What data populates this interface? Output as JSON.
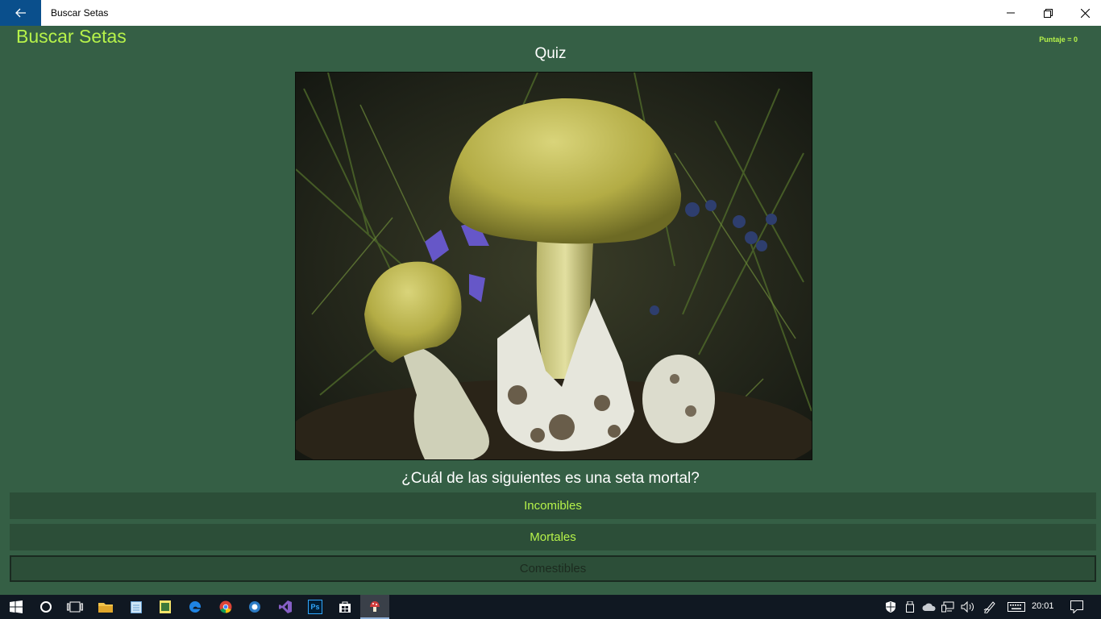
{
  "window": {
    "title": "Buscar Setas"
  },
  "app": {
    "title": "Buscar Setas",
    "score_label": "Puntaje = 0",
    "section_title": "Quiz",
    "question": "¿Cuál de las siguientes es una seta mortal?",
    "answers": [
      {
        "label": "Incomibles",
        "selected": false
      },
      {
        "label": "Mortales",
        "selected": false
      },
      {
        "label": "Comestibles",
        "selected": true
      }
    ],
    "accent_color": "#b6f24a",
    "background_color": "#355f45"
  },
  "taskbar": {
    "icons": [
      "windows-start-icon",
      "cortana-icon",
      "task-view-icon",
      "file-explorer-icon",
      "notepad-icon",
      "sticky-notes-icon",
      "edge-icon",
      "chrome-icon",
      "network-app-icon",
      "visual-studio-icon",
      "photoshop-icon",
      "store-icon",
      "buscar-setas-app-icon"
    ],
    "photoshop_label": "Ps",
    "clock": "20:01"
  }
}
